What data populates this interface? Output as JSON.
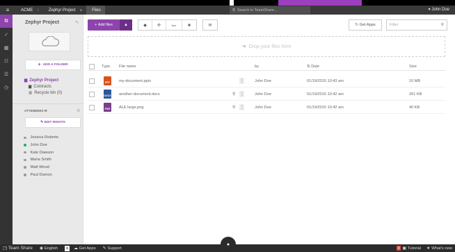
{
  "topbar": {
    "menu_icon": "hamburger-icon",
    "breadcrumbs": [
      "ACME",
      "Zephyr Project",
      "Files"
    ],
    "search_placeholder": "Search in TeamShare...",
    "user": "John Doe"
  },
  "rail": {
    "items": [
      "files-icon",
      "check-icon",
      "calendar-icon",
      "users-icon",
      "list-icon",
      "history-icon"
    ]
  },
  "sidebar": {
    "project_title": "Zephyr Project",
    "add_folder_label": "ADD A FOLDER",
    "tree": {
      "root": "Zephyr Project",
      "children": [
        "Contracts",
        "Recycle bin (0)"
      ]
    },
    "attendees_label": "ATTENDEES",
    "edit_rights_label": "EDIT RIGHTS",
    "people": [
      {
        "name": "Jessica Roberts",
        "online": false
      },
      {
        "name": "John Doe",
        "online": true
      },
      {
        "name": "Kate Dawson",
        "online": false
      },
      {
        "name": "Maria Smith",
        "online": false
      },
      {
        "name": "Matt Wood",
        "online": false
      },
      {
        "name": "Paul Damon",
        "online": false
      }
    ]
  },
  "toolbar": {
    "add_files_label": "Add files",
    "box_label": "box",
    "get_apps_label": "Get Apps",
    "filter_placeholder": "Filter"
  },
  "dropzone": {
    "label": "Drop your files here"
  },
  "table": {
    "headers": {
      "type": "Type",
      "file_name": "File name",
      "by": "by",
      "date": "Date",
      "size": "Size"
    },
    "rows": [
      {
        "type": "PPT",
        "file_name": "my-document.pptx",
        "by": "John Doe",
        "date": "01/19/2015 10:43 am",
        "size": "10 MB"
      },
      {
        "type": "DOCX",
        "file_name": "another-document.docx",
        "by": "John Doe",
        "date": "01/19/2015 10:42 am",
        "size": "261 KB"
      },
      {
        "type": "PNG",
        "file_name": "ALE large.png",
        "by": "John Doe",
        "date": "01/19/2015 10:42 am",
        "size": "40 KB"
      }
    ]
  },
  "bottombar": {
    "brand": "Team Share",
    "language": "English",
    "get_apps": "Get Apps",
    "support": "Support",
    "tutorial_badge": "4",
    "tutorial": "Tutorial",
    "whats_new": "What's new"
  },
  "colors": {
    "accent": "#8e44ad",
    "accent_dark": "#6c2f86",
    "topbar": "#3a3a3a",
    "rail": "#333333",
    "sidebar": "#e9e9e9"
  }
}
